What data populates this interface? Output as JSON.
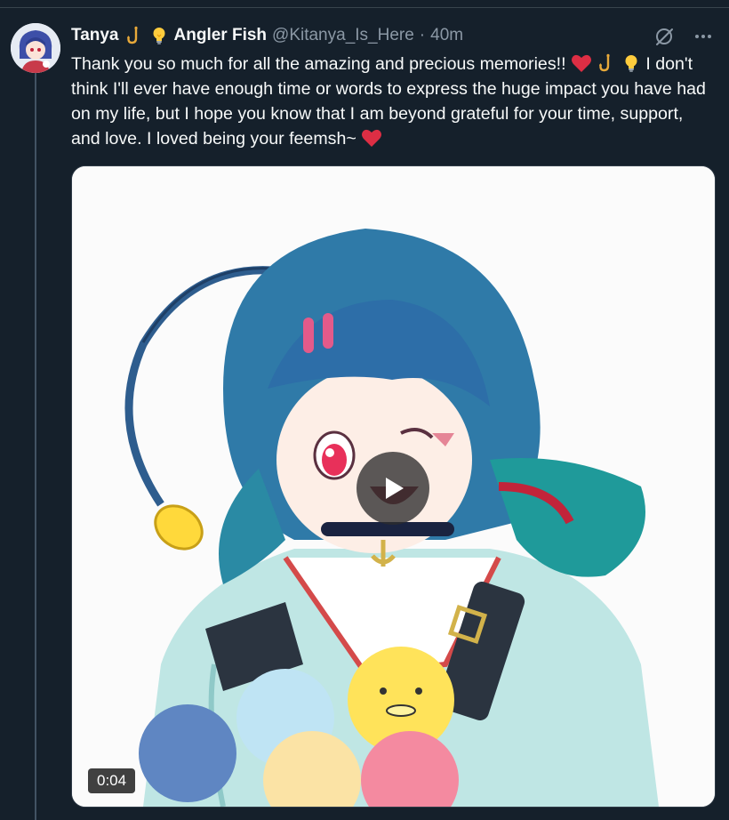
{
  "tweet": {
    "display_name": "Tanya",
    "display_name_suffix": "Angler Fish",
    "name_emojis": [
      "fishing-hook-icon",
      "light-bulb-icon"
    ],
    "handle": "@Kitanya_Is_Here",
    "separator": "·",
    "time": "40m",
    "text_part1": "Thank you so much for all the amazing and precious memories!! ",
    "text_part2": " I don't think I'll ever have enough time or words to express the huge impact you have had on my life, but I hope you know that I am beyond grateful for your time, support, and love. I loved being your feemsh~",
    "text_emojis": [
      "red-heart-icon",
      "fishing-hook-icon",
      "light-bulb-icon",
      "red-heart-icon"
    ]
  },
  "media": {
    "type": "video",
    "duration": "0:04"
  },
  "colors": {
    "background": "#15202b",
    "text": "#f7f9f9",
    "secondary_text": "#8b98a5",
    "thread_line": "#425364",
    "heart": "#f91c3d"
  }
}
